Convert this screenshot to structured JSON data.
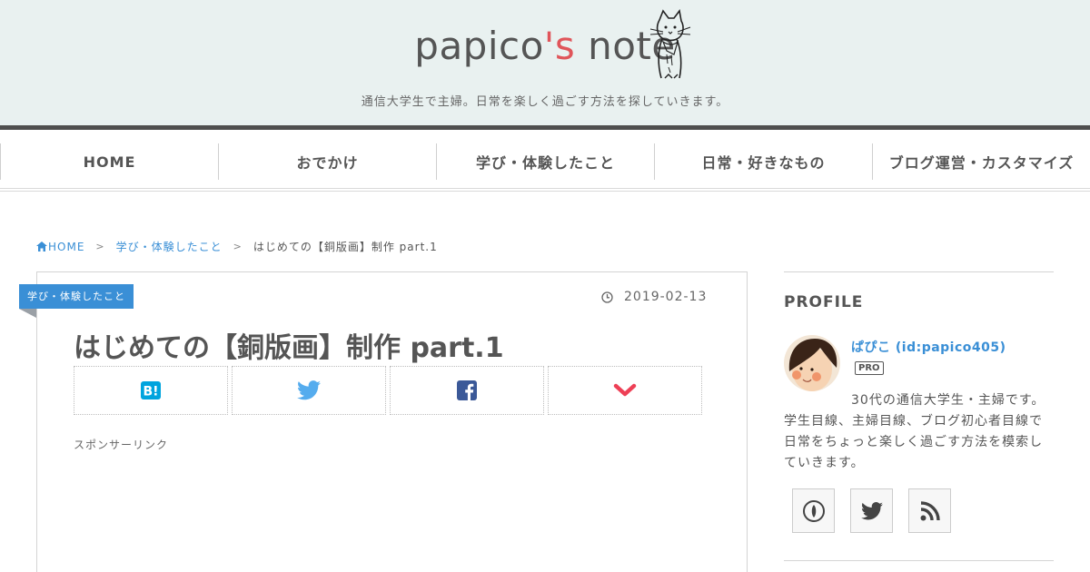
{
  "header": {
    "title_main": "papico",
    "title_accent": "'s",
    "title_rest": " note",
    "tagline": "通信大学生で主婦。日常を楽しく過ごす方法を探していきます。"
  },
  "nav": {
    "items": [
      {
        "label": "HOME"
      },
      {
        "label": "おでかけ"
      },
      {
        "label": "学び・体験したこと"
      },
      {
        "label": "日常・好きなもの"
      },
      {
        "label": "ブログ運営・カスタマイズ"
      }
    ]
  },
  "breadcrumb": {
    "home": "HOME",
    "category": "学び・体験したこと",
    "current": "はじめての【銅版画】制作 part.1"
  },
  "article": {
    "category_label": "学び・体験したこと",
    "date": "2019-02-13",
    "title": "はじめての【銅版画】制作 part.1",
    "sponsor": "スポンサーリンク",
    "share_icons": [
      "hatena-bookmark-icon",
      "twitter-icon",
      "facebook-icon",
      "chevron-down-icon"
    ]
  },
  "sidebar": {
    "heading": "PROFILE",
    "name": "ぱぴこ (id:papico405)",
    "pro": "PRO",
    "desc_line1": "30代の通信大学生・主婦です。",
    "desc_rest": "学生目線、主婦目線、ブログ初心者目線で日常をちょっと楽しく過ごす方法を模索していきます。",
    "icons": [
      "hatena-icon",
      "twitter-icon",
      "rss-icon"
    ]
  },
  "colors": {
    "header_bg": "#e9f1f0",
    "accent_red": "#e0555a",
    "link_blue": "#3a8fd6",
    "hatena_blue": "#00a4de",
    "twitter_blue": "#55acee",
    "facebook_blue": "#3b5998",
    "pocket_red": "#ee4056"
  }
}
